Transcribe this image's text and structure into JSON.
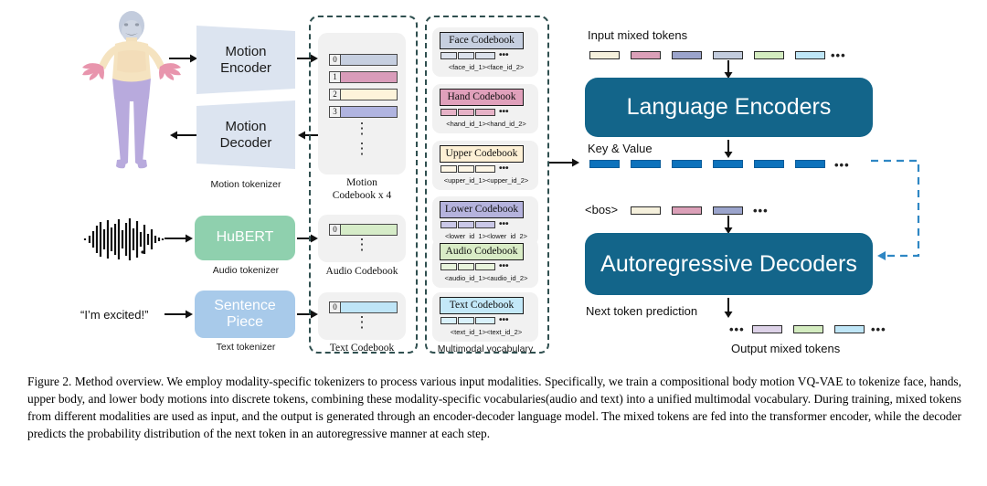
{
  "figure": {
    "number": "Figure 2.",
    "caption": "Figure 2. Method overview. We employ modality-specific tokenizers to process various input modalities. Specifically, we train a compositional body motion VQ-VAE to tokenize face, hands, upper body, and lower body motions into discrete tokens, combining these modality-specific vocabularies(audio and text) into a unified multimodal vocabulary. During training, mixed tokens from different modalities are used as input, and the output is generated through an encoder-decoder language model. The mixed tokens are fed into the transformer encoder, while the decoder predicts the probability distribution of the next token in an autoregressive manner at each step."
  },
  "tokenizers": {
    "motion": {
      "encoder_label": "Motion\nEncoder",
      "encoder_line1": "Motion",
      "encoder_line2": "Encoder",
      "decoder_line1": "Motion",
      "decoder_line2": "Decoder",
      "caption": "Motion tokenizer",
      "block_color": "#dce4f0"
    },
    "audio": {
      "label": "HuBERT",
      "caption": "Audio tokenizer",
      "block_color": "#8fd0ae"
    },
    "text": {
      "input_text": "“I’m excited!”",
      "label_line1": "Sentence",
      "label_line2": "Piece",
      "caption": "Text tokenizer",
      "block_color": "#a8caea"
    }
  },
  "codebooks_panel": {
    "motion": {
      "caption_line1": "Motion",
      "caption_line2": "Codebook x 4",
      "entries": [
        {
          "index": "0",
          "color": "#c6cfe0"
        },
        {
          "index": "1",
          "color": "#d99cba"
        },
        {
          "index": "2",
          "color": "#fdf3da"
        },
        {
          "index": "3",
          "color": "#b0b4e0"
        }
      ],
      "ellipsis": "⋮"
    },
    "audio": {
      "caption": "Audio Codebook",
      "entries": [
        {
          "index": "0",
          "color": "#d6ecc8"
        }
      ],
      "ellipsis": "⋮"
    },
    "text": {
      "caption": "Text Codebook",
      "entries": [
        {
          "index": "0",
          "color": "#bfe5f7"
        }
      ],
      "ellipsis": "⋮"
    }
  },
  "vocabulary_panel": {
    "caption": "Multimodal vocabulary",
    "dots": "•••",
    "codebooks": [
      {
        "title": "Face Codebook",
        "color": "#c6cfe0",
        "ids": "<face_id_1><face_id_2>"
      },
      {
        "title": "Hand Codebook",
        "color": "#e0a0bb",
        "ids": "<hand_id_1><hand_id_2>"
      },
      {
        "title": "Upper Codebook",
        "color": "#fdf0d5",
        "ids": "<upper_id_1><upper_id_2>"
      },
      {
        "title": "Lower Codebook",
        "color": "#b5b3dd",
        "ids": "<lower_id_1><lower_id_2>"
      },
      {
        "title": "Audio Codebook",
        "color": "#d9ecc6",
        "ids": "<audio_id_1><audio_id_2>"
      },
      {
        "title": "Text Codebook",
        "color": "#c3e8f8",
        "ids": "<text_id_1><text_id_2>"
      }
    ]
  },
  "model": {
    "input_tokens_label": "Input mixed tokens",
    "encoder_label": "Language Encoders",
    "key_value_label": "Key & Value",
    "bos_label": "<bos>",
    "decoder_label": "Autoregressive Decoders",
    "next_token_label": "Next token prediction",
    "output_tokens_label": "Output mixed tokens",
    "dots": "•••",
    "block_color": "#13658a",
    "kv_color": "#0d72bc",
    "input_token_colors": [
      "#f5f0dc",
      "#dba0b8",
      "#9ba4cc",
      "#c3ccdd",
      "#d4ecc0",
      "#bfe6f7"
    ],
    "decoder_input_token_colors": [
      "#f5f0dc",
      "#dba0b8",
      "#9ba4cc"
    ],
    "output_token_colors": [
      "#ddd2e8",
      "#d4ecc0",
      "#bfe6f7"
    ],
    "kv_token_count": 6
  }
}
